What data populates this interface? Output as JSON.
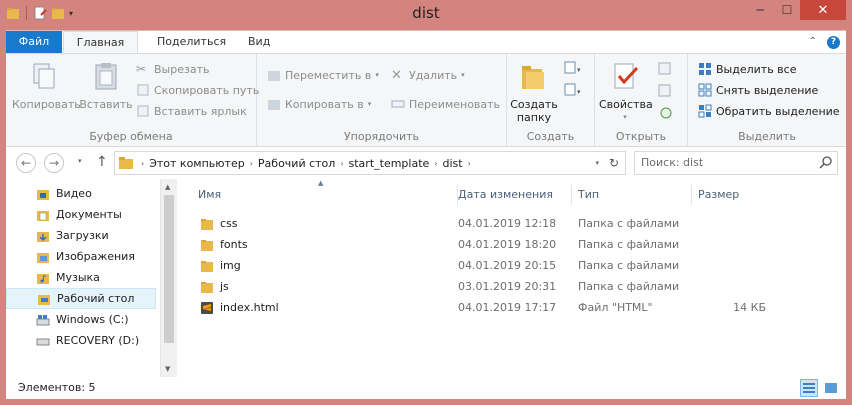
{
  "window": {
    "title": "dist",
    "min_icon": "minimize-icon",
    "max_icon": "maximize-icon",
    "close_icon": "close-icon"
  },
  "colors": {
    "frame": "#d4847e",
    "file_tab": "#1979ca",
    "ribbon_bg": "#f5f6f7",
    "selected_bg": "#e5f3fb",
    "folder_yellow": "#e8b94a",
    "close_red": "#c7483b"
  },
  "tabs": {
    "file": "Файл",
    "home": "Главная",
    "share": "Поделиться",
    "view": "Вид"
  },
  "ribbon": {
    "clipboard": {
      "label": "Буфер обмена",
      "copy": "Копировать",
      "paste": "Вставить",
      "cut": "Вырезать",
      "copy_path": "Скопировать путь",
      "paste_shortcut": "Вставить ярлык"
    },
    "organize": {
      "label": "Упорядочить",
      "move_to": "Переместить в",
      "copy_to": "Копировать в",
      "delete": "Удалить",
      "rename": "Переименовать"
    },
    "new": {
      "label": "Создать",
      "new_folder_line1": "Создать",
      "new_folder_line2": "папку"
    },
    "open": {
      "label": "Открыть",
      "properties": "Свойства"
    },
    "select": {
      "label": "Выделить",
      "select_all": "Выделить все",
      "select_none": "Снять выделение",
      "invert": "Обратить выделение"
    }
  },
  "address": {
    "crumbs": [
      "Этот компьютер",
      "Рабочий стол",
      "start_template",
      "dist"
    ],
    "search_placeholder": "Поиск: dist"
  },
  "nav_pane": {
    "items": [
      {
        "label": "Видео",
        "icon": "video-folder-icon"
      },
      {
        "label": "Документы",
        "icon": "documents-folder-icon"
      },
      {
        "label": "Загрузки",
        "icon": "downloads-folder-icon"
      },
      {
        "label": "Изображения",
        "icon": "pictures-folder-icon"
      },
      {
        "label": "Музыка",
        "icon": "music-folder-icon"
      },
      {
        "label": "Рабочий стол",
        "icon": "desktop-folder-icon",
        "selected": true
      },
      {
        "label": "Windows (C:)",
        "icon": "drive-c-icon"
      },
      {
        "label": "RECOVERY (D:)",
        "icon": "drive-d-icon"
      }
    ]
  },
  "columns": {
    "name": "Имя",
    "date": "Дата изменения",
    "type": "Тип",
    "size": "Размер"
  },
  "files": [
    {
      "name": "css",
      "date": "04.01.2019 12:18",
      "type": "Папка с файлами",
      "size": "",
      "icon": "folder-icon"
    },
    {
      "name": "fonts",
      "date": "04.01.2019 18:20",
      "type": "Папка с файлами",
      "size": "",
      "icon": "folder-icon"
    },
    {
      "name": "img",
      "date": "04.01.2019 20:15",
      "type": "Папка с файлами",
      "size": "",
      "icon": "folder-icon"
    },
    {
      "name": "js",
      "date": "03.01.2019 20:31",
      "type": "Папка с файлами",
      "size": "",
      "icon": "folder-icon"
    },
    {
      "name": "index.html",
      "date": "04.01.2019 17:17",
      "type": "Файл \"HTML\"",
      "size": "14 КБ",
      "icon": "sublime-file-icon"
    }
  ],
  "status": {
    "items_count": "Элементов: 5"
  }
}
